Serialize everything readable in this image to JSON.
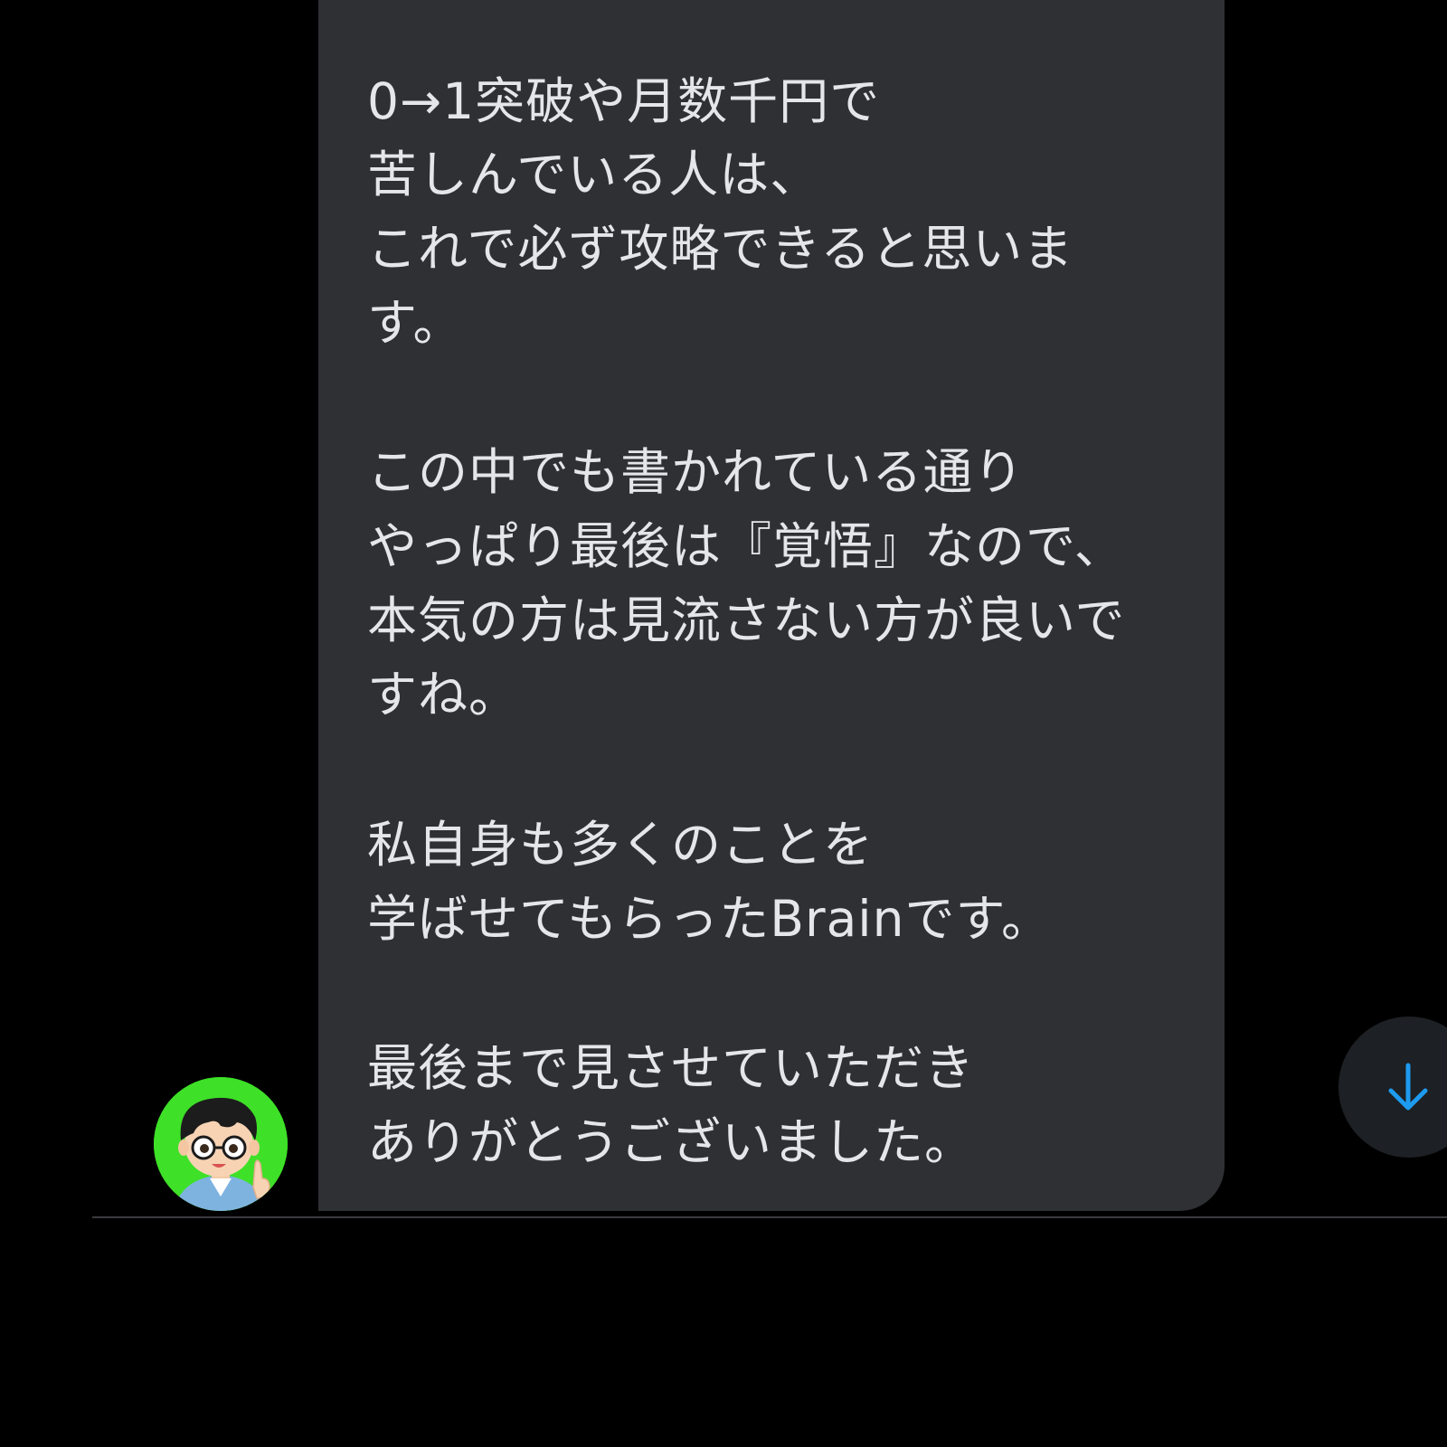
{
  "message": {
    "lines": [
      "0→1突破や月数千円で",
      "苦しんでいる人は、",
      "これで必ず攻略できると思いま",
      "す。",
      "この中でも書かれている通り",
      "やっぱり最後は『覚悟』なので、",
      "本気の方は見流さない方が良いで",
      "すね。",
      "私自身も多くのことを",
      "学ばせてもらったBrainです。",
      "最後まで見させていただき",
      "ありがとうございました。"
    ]
  },
  "avatar": {
    "icon": "cartoon-boy-with-glasses",
    "background": "#3ee028"
  },
  "scroll_button": {
    "icon": "arrow-down-icon",
    "color": "#1d9bf0"
  },
  "colors": {
    "background": "#000000",
    "bubble": "#2f3033",
    "text": "#e4e6ea",
    "accent": "#1d9bf0"
  }
}
